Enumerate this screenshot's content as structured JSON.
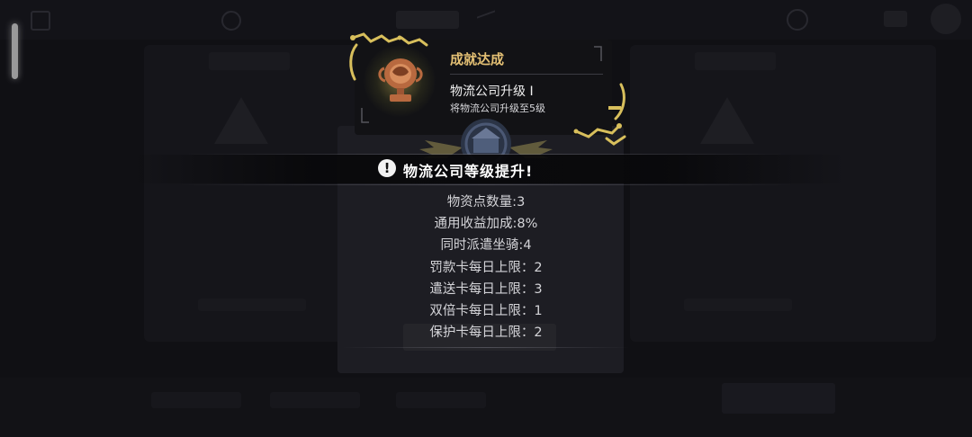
{
  "achievement": {
    "header": "成就达成",
    "name": "物流公司升级 Ⅰ",
    "description": "将物流公司升级至5级",
    "icon": "trophy-icon",
    "frame_color": "#d8bf5c"
  },
  "notice": {
    "title": "物流公司等级提升!",
    "icon": "exclamation-icon"
  },
  "stats": [
    "物资点数量:3",
    "通用收益加成:8%",
    "同时派遣坐骑:4",
    "罚款卡每日上限：2",
    "遣送卡每日上限：3",
    "双倍卡每日上限：1",
    "保护卡每日上限：2"
  ],
  "colors": {
    "accent_gold": "#e4c074",
    "text": "#d4d4d8",
    "background": "#141419"
  }
}
